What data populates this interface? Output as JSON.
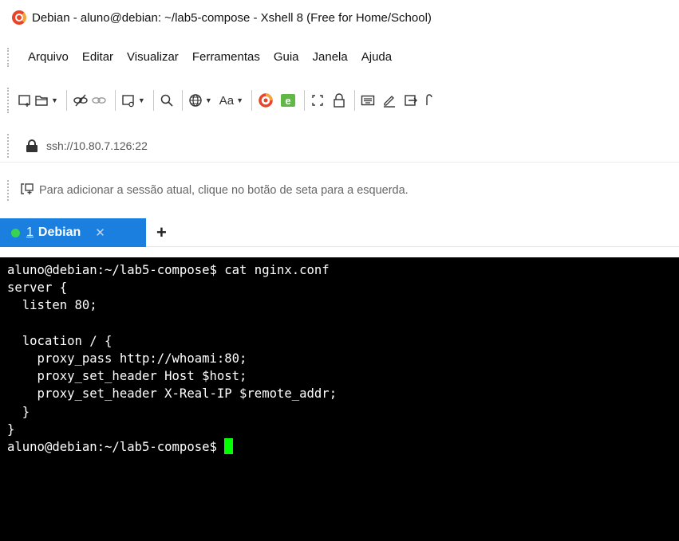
{
  "window": {
    "title": "Debian - aluno@debian: ~/lab5-compose - Xshell 8 (Free for Home/School)",
    "logo_icon": "xshell-logo-icon"
  },
  "menu": {
    "items": [
      "Arquivo",
      "Editar",
      "Visualizar",
      "Ferramentas",
      "Guia",
      "Janela",
      "Ajuda"
    ]
  },
  "toolbar": {
    "icons": [
      "new-session-icon",
      "open-folder-icon",
      "disconnect-icon",
      "link-icon",
      "new-tab-icon",
      "find-icon",
      "globe-icon",
      "font-icon",
      "xshell-icon",
      "xftp-icon",
      "fullscreen-icon",
      "lock-icon",
      "keyboard-icon",
      "compose-icon",
      "transfer-icon"
    ],
    "font_label": "Aa"
  },
  "address": {
    "value": "ssh://10.80.7.126:22"
  },
  "hint": {
    "text": "Para adicionar a sessão atual, clique no botão de seta para a esquerda."
  },
  "tabs": {
    "items": [
      {
        "number": "1",
        "label": "Debian",
        "status_color": "#39d353"
      }
    ],
    "accent": "#1b7fe0",
    "add_label": "+"
  },
  "terminal": {
    "lines": [
      "aluno@debian:~/lab5-compose$ cat nginx.conf",
      "server {",
      "  listen 80;",
      "",
      "  location / {",
      "    proxy_pass http://whoami:80;",
      "    proxy_set_header Host $host;",
      "    proxy_set_header X-Real-IP $remote_addr;",
      "  }",
      "}"
    ],
    "prompt": "aluno@debian:~/lab5-compose$ ",
    "cursor_color": "#00ff00"
  }
}
